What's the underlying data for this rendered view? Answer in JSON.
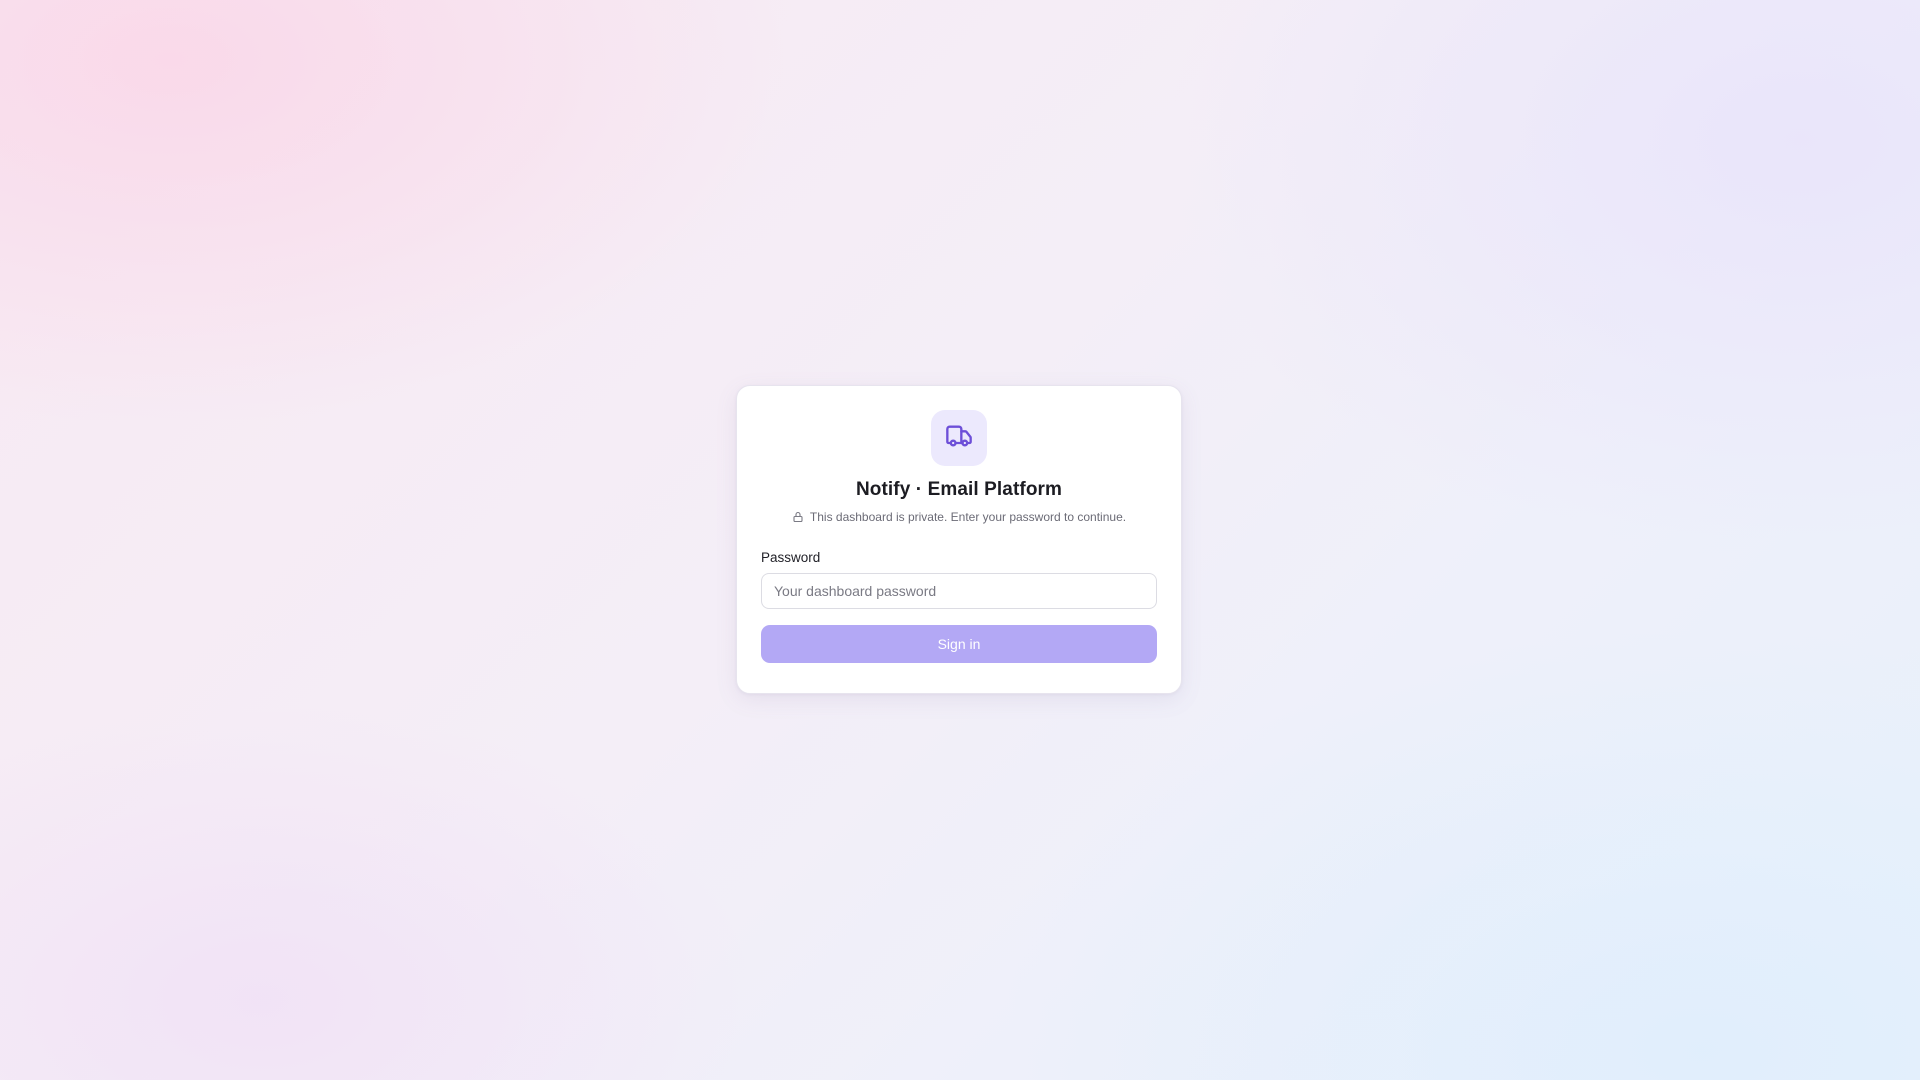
{
  "app": {
    "title": "Notify · Email Platform",
    "subtitle": "This dashboard is private. Enter your password to continue.",
    "logo_icon": "truck-icon",
    "subtitle_icon": "lock-icon"
  },
  "form": {
    "password_label": "Password",
    "password_value": "",
    "password_placeholder": "Your dashboard password",
    "submit_label": "Sign in"
  },
  "colors": {
    "accent": "#6d4fd8",
    "logo_tile_bg": "#ece9fd",
    "button_bg": "#b3a8f5",
    "button_text": "#ffffff"
  }
}
